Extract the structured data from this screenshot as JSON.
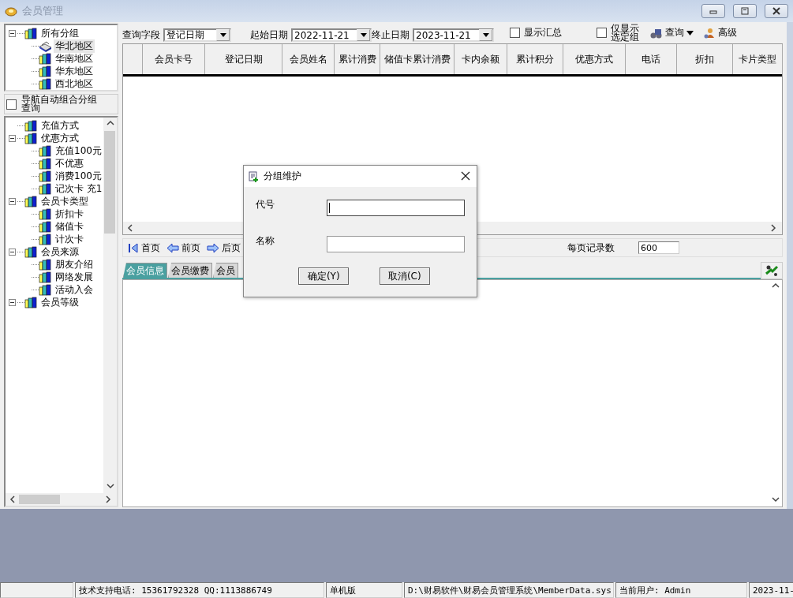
{
  "window": {
    "title": "会员管理"
  },
  "group_tree": {
    "items": [
      {
        "label": "所有分组",
        "expanded": true,
        "selected": false,
        "children": [
          {
            "label": "华北地区",
            "selected": true
          },
          {
            "label": "华南地区",
            "selected": false
          },
          {
            "label": "华东地区",
            "selected": false
          },
          {
            "label": "西北地区",
            "selected": false
          }
        ]
      }
    ]
  },
  "nav_option": {
    "label": "导航自动组合分组查询",
    "checked": false
  },
  "category_tree": {
    "items": [
      {
        "label": "充值方式"
      },
      {
        "label": "优惠方式",
        "expanded": true,
        "children": [
          {
            "label": "充值100元"
          },
          {
            "label": "不优惠"
          },
          {
            "label": "消费100元"
          },
          {
            "label": "记次卡 充1"
          }
        ]
      },
      {
        "label": "会员卡类型",
        "expanded": true,
        "children": [
          {
            "label": "折扣卡"
          },
          {
            "label": "储值卡"
          },
          {
            "label": "计次卡"
          }
        ]
      },
      {
        "label": "会员来源",
        "expanded": true,
        "children": [
          {
            "label": "朋友介绍"
          },
          {
            "label": "网络发展"
          },
          {
            "label": "活动入会"
          }
        ]
      },
      {
        "label": "会员等级",
        "expanded": true
      }
    ]
  },
  "toolbar": {
    "query_field": {
      "label": "查询字段",
      "value": "登记日期"
    },
    "start_date": {
      "label": "起始日期",
      "value": "2022-11-21"
    },
    "end_date": {
      "label": "终止日期",
      "value": "2023-11-21"
    },
    "checkboxes": [
      {
        "label": "显示汇总",
        "checked": false
      },
      {
        "label": "仅显示选定组",
        "checked": false
      }
    ],
    "buttons": [
      {
        "label": "查询",
        "kind": "dropdown"
      },
      {
        "label": "高级",
        "kind": "plain"
      }
    ]
  },
  "table": {
    "columns": [
      "会员卡号",
      "登记日期",
      "会员姓名",
      "累计消费",
      "储值卡累计消费",
      "卡内余额",
      "累计积分",
      "优惠方式",
      "电话",
      "折扣",
      "卡片类型"
    ]
  },
  "pager": {
    "buttons": [
      {
        "label": "首页",
        "kind": "first"
      },
      {
        "label": "前页",
        "kind": "prev"
      },
      {
        "label": "后页",
        "kind": "next"
      }
    ],
    "page_size": {
      "label": "每页记录数",
      "value": "600"
    }
  },
  "tabs": [
    {
      "label": "会员信息",
      "selected": true
    },
    {
      "label": "会员缴费",
      "selected": false
    },
    {
      "label": "会员",
      "selected": false
    }
  ],
  "dialog": {
    "title": "分组维护",
    "fields": [
      {
        "label": "代号",
        "focused": true
      },
      {
        "label": "名称",
        "focused": false
      }
    ],
    "buttons": [
      "确定(Y)",
      "取消(C)"
    ]
  },
  "status_bar": [
    "技术支持电话: 15361792328 QQ:1113886749",
    "单机版",
    "D:\\财易软件\\财易会员管理系统\\MemberData.sys",
    "当前用户: Admin",
    "2023-11-"
  ]
}
